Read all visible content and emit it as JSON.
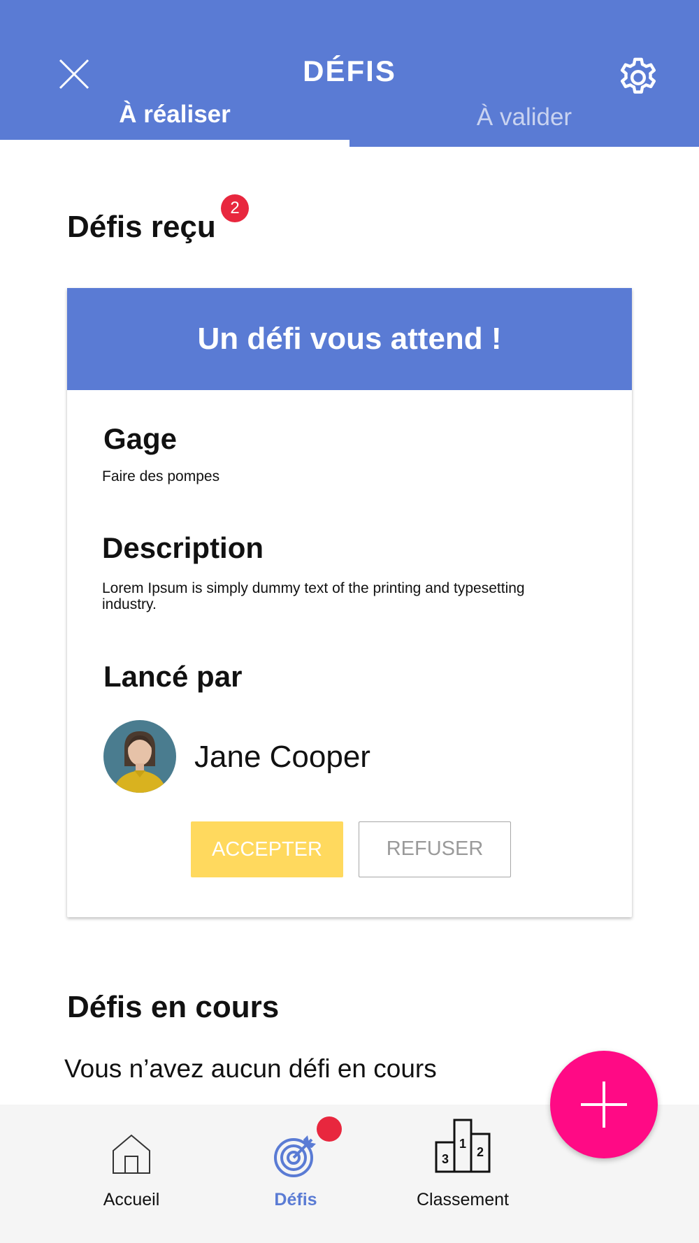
{
  "header": {
    "title": "DÉFIS",
    "close_icon": "close-icon",
    "settings_icon": "gear-icon",
    "tabs": [
      {
        "label": "À réaliser",
        "active": true
      },
      {
        "label": "À valider",
        "active": false
      }
    ]
  },
  "received": {
    "title": "Défis reçu",
    "badge_count": "2",
    "card": {
      "banner": "Un défi vous attend !",
      "gage_heading": "Gage",
      "gage_text": "Faire des pompes",
      "description_heading": "Description",
      "description_text": "Lorem Ipsum is simply dummy text of the printing and typesetting industry.",
      "launched_by_heading": "Lancé par",
      "author_name": "Jane Cooper",
      "accept_label": "ACCEPTER",
      "refuse_label": "REFUSER"
    }
  },
  "ongoing": {
    "title": "Défis en cours",
    "empty_text": "Vous n’avez aucun défi en cours"
  },
  "bottom_nav": {
    "items": [
      {
        "label": "Accueil",
        "icon": "home-icon",
        "active": false
      },
      {
        "label": "Défis",
        "icon": "target-icon",
        "active": true
      },
      {
        "label": "Classement",
        "icon": "podium-icon",
        "active": false
      }
    ]
  },
  "fab": {
    "icon": "plus-icon"
  },
  "colors": {
    "primary": "#5A7BD4",
    "badge": "#E8273E",
    "accept": "#FFD95E",
    "fab": "#FF0A85"
  }
}
